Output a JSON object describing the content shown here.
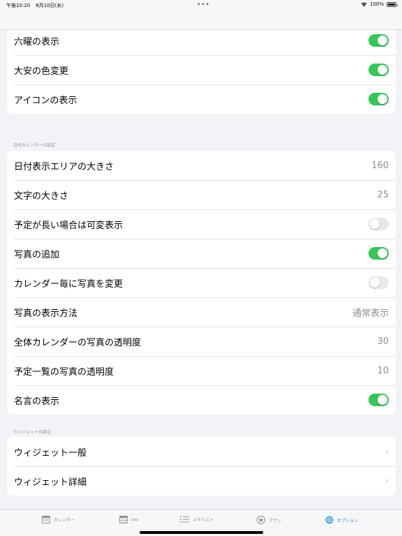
{
  "status_bar": {
    "time": "午後10:20",
    "date": "8月10日(水)",
    "dots": "•••",
    "battery": "100%"
  },
  "sections": {
    "top_rows": [
      {
        "label": "",
        "type": "toggle",
        "on": true
      },
      {
        "label": "六曜の表示",
        "type": "toggle",
        "on": true
      },
      {
        "label": "大安の色変更",
        "type": "toggle",
        "on": true
      },
      {
        "label": "アイコンの表示",
        "type": "toggle",
        "on": true
      }
    ],
    "day_calendar": {
      "header": "日のカレンダーの設定",
      "rows": [
        {
          "label": "日付表示エリアの大きさ",
          "type": "value",
          "value": "160"
        },
        {
          "label": "文字の大きさ",
          "type": "value",
          "value": "25"
        },
        {
          "label": "予定が長い場合は可変表示",
          "type": "toggle",
          "on": false
        },
        {
          "label": "写真の追加",
          "type": "toggle",
          "on": true
        },
        {
          "label": "カレンダー毎に写真を変更",
          "type": "toggle",
          "on": false
        },
        {
          "label": "写真の表示方法",
          "type": "value",
          "value": "通常表示"
        },
        {
          "label": "全体カレンダーの写真の透明度",
          "type": "value",
          "value": "30"
        },
        {
          "label": "予定一覧の写真の透明度",
          "type": "value",
          "value": "10"
        },
        {
          "label": "名言の表示",
          "type": "toggle",
          "on": true
        }
      ]
    },
    "widget": {
      "header": "ウィジェットの設定",
      "rows": [
        {
          "label": "ウィジェット一般",
          "type": "chevron",
          "chevron": "›"
        },
        {
          "label": "ウィジェット詳細",
          "type": "chevron",
          "chevron": "›"
        }
      ]
    }
  },
  "tab_bar": {
    "tabs": [
      {
        "label": "カレンダー",
        "icon": "calendar-icon",
        "active": false
      },
      {
        "label": "ωω",
        "icon": "calendar-grid-icon",
        "active": false
      },
      {
        "label": "メモリスト",
        "icon": "list-icon",
        "active": false
      },
      {
        "label": "プラン",
        "icon": "star-icon",
        "active": false
      },
      {
        "label": "オプション",
        "icon": "gear-icon",
        "active": true
      }
    ]
  },
  "colors": {
    "toggle_on": "#34c759",
    "toggle_off": "#e9e9eb",
    "active_tab": "#1a8ad6",
    "background": "#f2f2f7"
  }
}
